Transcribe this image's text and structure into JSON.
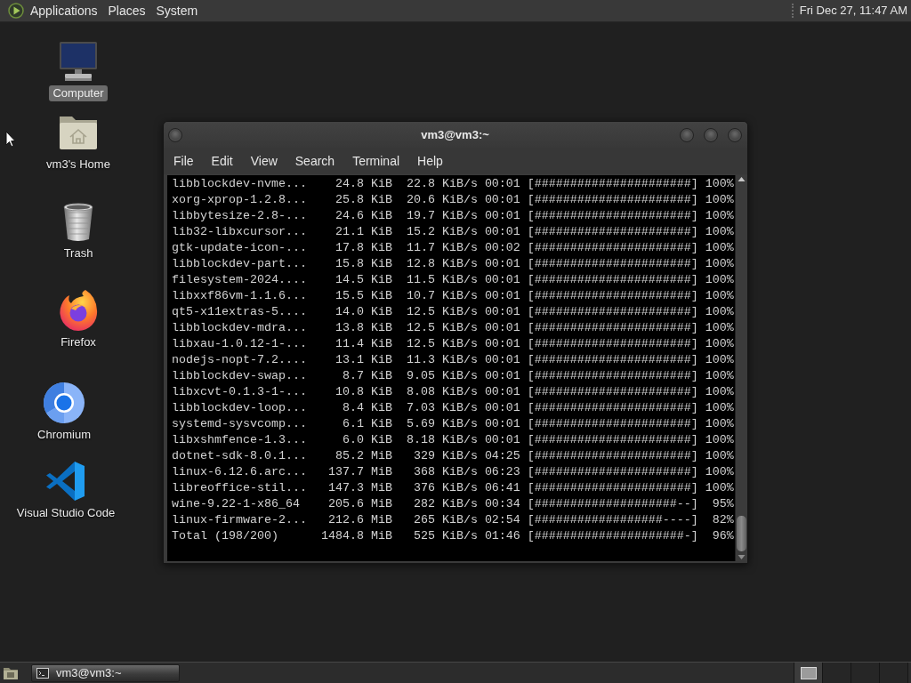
{
  "top_panel": {
    "menus": [
      "Applications",
      "Places",
      "System"
    ],
    "clock": "Fri Dec 27, 11:47 AM"
  },
  "desktop_icons": [
    {
      "kind": "computer",
      "label": "Computer",
      "selected": true
    },
    {
      "kind": "home",
      "label": "vm3's Home",
      "selected": false
    },
    {
      "kind": "trash",
      "label": "Trash",
      "selected": false
    },
    {
      "kind": "firefox",
      "label": "Firefox",
      "selected": false
    },
    {
      "kind": "chromium",
      "label": "Chromium",
      "selected": false
    },
    {
      "kind": "vscode",
      "label": "Visual Studio Code",
      "selected": false
    }
  ],
  "terminal_window": {
    "title": "vm3@vm3:~",
    "menus": [
      "File",
      "Edit",
      "View",
      "Search",
      "Terminal",
      "Help"
    ],
    "lines": [
      {
        "name": "libblockdev-nvme...",
        "size": "24.8 KiB",
        "rate": "22.8 KiB/s",
        "time": "00:01",
        "bar": "[######################]",
        "percent": "100%"
      },
      {
        "name": "xorg-xprop-1.2.8...",
        "size": "25.8 KiB",
        "rate": "20.6 KiB/s",
        "time": "00:01",
        "bar": "[######################]",
        "percent": "100%"
      },
      {
        "name": "libbytesize-2.8-...",
        "size": "24.6 KiB",
        "rate": "19.7 KiB/s",
        "time": "00:01",
        "bar": "[######################]",
        "percent": "100%"
      },
      {
        "name": "lib32-libxcursor...",
        "size": "21.1 KiB",
        "rate": "15.2 KiB/s",
        "time": "00:01",
        "bar": "[######################]",
        "percent": "100%"
      },
      {
        "name": "gtk-update-icon-...",
        "size": "17.8 KiB",
        "rate": "11.7 KiB/s",
        "time": "00:02",
        "bar": "[######################]",
        "percent": "100%"
      },
      {
        "name": "libblockdev-part...",
        "size": "15.8 KiB",
        "rate": "12.8 KiB/s",
        "time": "00:01",
        "bar": "[######################]",
        "percent": "100%"
      },
      {
        "name": "filesystem-2024....",
        "size": "14.5 KiB",
        "rate": "11.5 KiB/s",
        "time": "00:01",
        "bar": "[######################]",
        "percent": "100%"
      },
      {
        "name": "libxxf86vm-1.1.6...",
        "size": "15.5 KiB",
        "rate": "10.7 KiB/s",
        "time": "00:01",
        "bar": "[######################]",
        "percent": "100%"
      },
      {
        "name": "qt5-x11extras-5....",
        "size": "14.0 KiB",
        "rate": "12.5 KiB/s",
        "time": "00:01",
        "bar": "[######################]",
        "percent": "100%"
      },
      {
        "name": "libblockdev-mdra...",
        "size": "13.8 KiB",
        "rate": "12.5 KiB/s",
        "time": "00:01",
        "bar": "[######################]",
        "percent": "100%"
      },
      {
        "name": "libxau-1.0.12-1-...",
        "size": "11.4 KiB",
        "rate": "12.5 KiB/s",
        "time": "00:01",
        "bar": "[######################]",
        "percent": "100%"
      },
      {
        "name": "nodejs-nopt-7.2....",
        "size": "13.1 KiB",
        "rate": "11.3 KiB/s",
        "time": "00:01",
        "bar": "[######################]",
        "percent": "100%"
      },
      {
        "name": "libblockdev-swap...",
        "size": "8.7 KiB",
        "rate": "9.05 KiB/s",
        "time": "00:01",
        "bar": "[######################]",
        "percent": "100%"
      },
      {
        "name": "libxcvt-0.1.3-1-...",
        "size": "10.8 KiB",
        "rate": "8.08 KiB/s",
        "time": "00:01",
        "bar": "[######################]",
        "percent": "100%"
      },
      {
        "name": "libblockdev-loop...",
        "size": "8.4 KiB",
        "rate": "7.03 KiB/s",
        "time": "00:01",
        "bar": "[######################]",
        "percent": "100%"
      },
      {
        "name": "systemd-sysvcomp...",
        "size": "6.1 KiB",
        "rate": "5.69 KiB/s",
        "time": "00:01",
        "bar": "[######################]",
        "percent": "100%"
      },
      {
        "name": "libxshmfence-1.3...",
        "size": "6.0 KiB",
        "rate": "8.18 KiB/s",
        "time": "00:01",
        "bar": "[######################]",
        "percent": "100%"
      },
      {
        "name": "dotnet-sdk-8.0.1...",
        "size": "85.2 MiB",
        "rate": "329 KiB/s",
        "time": "04:25",
        "bar": "[######################]",
        "percent": "100%"
      },
      {
        "name": "linux-6.12.6.arc...",
        "size": "137.7 MiB",
        "rate": "368 KiB/s",
        "time": "06:23",
        "bar": "[######################]",
        "percent": "100%"
      },
      {
        "name": "libreoffice-stil...",
        "size": "147.3 MiB",
        "rate": "376 KiB/s",
        "time": "06:41",
        "bar": "[######################]",
        "percent": "100%"
      },
      {
        "name": "wine-9.22-1-x86_64",
        "size": "205.6 MiB",
        "rate": "282 KiB/s",
        "time": "00:34",
        "bar": "[####################--]",
        "percent": "95%"
      },
      {
        "name": "linux-firmware-2...",
        "size": "212.6 MiB",
        "rate": "265 KiB/s",
        "time": "02:54",
        "bar": "[##################----]",
        "percent": "82%"
      },
      {
        "name": "Total (198/200)",
        "size": "1484.8 MiB",
        "rate": "525 KiB/s",
        "time": "01:46",
        "bar": "[#####################-]",
        "percent": "96%"
      }
    ]
  },
  "bottom_panel": {
    "tasks": [
      {
        "label": "vm3@vm3:~",
        "selected": true
      }
    ],
    "workspaces": [
      {
        "selected": true,
        "has_window": true
      },
      {
        "selected": false
      },
      {
        "selected": false
      },
      {
        "selected": false
      }
    ]
  }
}
